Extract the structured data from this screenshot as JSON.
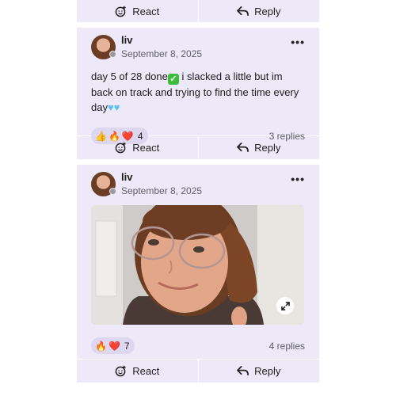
{
  "actions": {
    "react_label": "React",
    "reply_label": "Reply"
  },
  "posts": [
    {
      "author": "liv",
      "date": "September 8, 2025",
      "text_part1": "day 5 of 28 done",
      "text_part2": " i slacked a little but im back on track and trying to find the time every day",
      "reactions": [
        "👍",
        "🔥",
        "❤️"
      ],
      "reaction_count": "4",
      "replies": "3 replies"
    },
    {
      "author": "liv",
      "date": "September 8, 2025",
      "reactions": [
        "🔥",
        "❤️"
      ],
      "reaction_count": "7",
      "replies": "4 replies"
    }
  ],
  "icons": {
    "react": "smiley-plus-icon",
    "reply": "reply-arrow-icon",
    "more": "more-dots-icon",
    "expand": "expand-arrows-icon"
  },
  "colors": {
    "card_bg": "#ede9f8",
    "reaction_pill": "#ddd7ef"
  }
}
